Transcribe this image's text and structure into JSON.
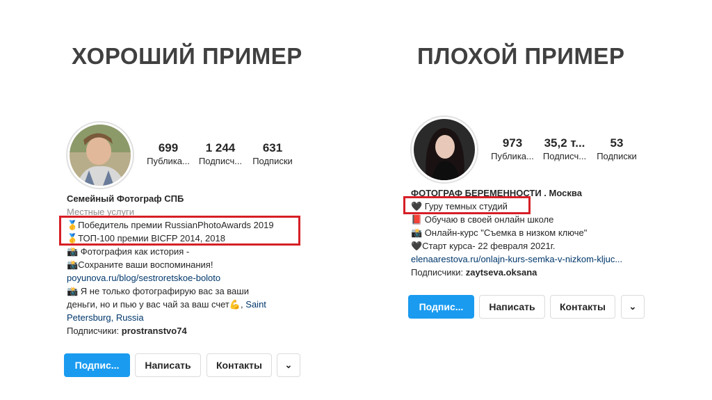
{
  "left": {
    "heading": "ХОРОШИЙ ПРИМЕР",
    "stats": [
      {
        "value": "699",
        "label": "Публика..."
      },
      {
        "value": "1 244",
        "label": "Подписч..."
      },
      {
        "value": "631",
        "label": "Подписки"
      }
    ],
    "name": "Семейный Фотограф СПБ",
    "category": "Местные услуги",
    "highlight": [
      "🥇Победитель премии RussianPhotoAwards 2019",
      "🥇ТОП-100 премии BICFP 2014, 2018"
    ],
    "bio": [
      "📸 Фотография как история -",
      "📸Сохраните ваши воспоминания!"
    ],
    "link": "poyunova.ru/blog/sestroretskoe-boloto",
    "bio2_prefix": "📸 Я не только фотографирую вас за ваши",
    "bio2_line2": "деньги, но и пью у вас чай за ваш счет💪, ",
    "bio2_link1": "Saint",
    "bio2_link2": "Petersburg, Russia",
    "followers_prefix": "Подписчики: ",
    "followers_user": "prostranstvo74",
    "buttons": {
      "follow": "Подпис...",
      "message": "Написать",
      "contacts": "Контакты",
      "more": "⌄"
    }
  },
  "right": {
    "heading": "ПЛОХОЙ ПРИМЕР",
    "stats": [
      {
        "value": "973",
        "label": "Публика..."
      },
      {
        "value": "35,2 т...",
        "label": "Подписч..."
      },
      {
        "value": "53",
        "label": "Подписки"
      }
    ],
    "name": "ФОТОГРАФ БЕРЕМЕННОСТИ . Москва",
    "highlight": "🖤 Гуру темных студий",
    "bio": [
      "📕 Обучаю в своей онлайн школе",
      "📸 Онлайн-курс \"Съемка в низком ключе\"",
      "🖤Старт курса- 22 февраля 2021г."
    ],
    "link": "elenaarestova.ru/onlajn-kurs-semka-v-nizkom-kljuc...",
    "followers_prefix": "Подписчики: ",
    "followers_user": "zaytseva.oksana",
    "buttons": {
      "follow": "Подпис...",
      "message": "Написать",
      "contacts": "Контакты",
      "more": "⌄"
    }
  },
  "colors": {
    "highlight_border": "#d61f26",
    "primary_button": "#1a9bf0",
    "link": "#00376b"
  }
}
